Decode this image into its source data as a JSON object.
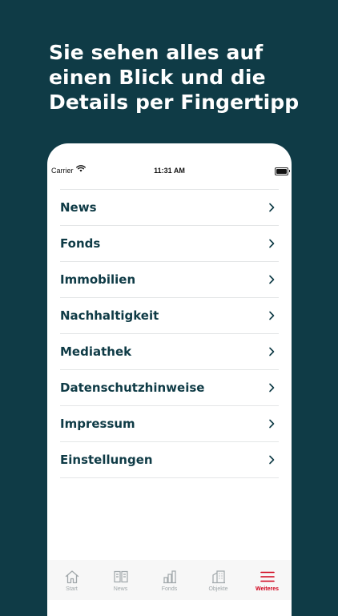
{
  "headline": "Sie sehen alles auf einen Blick und die Details per Fingertipp",
  "status_bar": {
    "carrier": "Carrier",
    "time": "11:31 AM"
  },
  "menu": {
    "items": [
      {
        "label": "News"
      },
      {
        "label": "Fonds"
      },
      {
        "label": "Immobilien"
      },
      {
        "label": "Nachhaltigkeit"
      },
      {
        "label": "Mediathek"
      },
      {
        "label": "Datenschutzhinweise"
      },
      {
        "label": "Impressum"
      },
      {
        "label": "Einstellungen"
      }
    ]
  },
  "tabbar": {
    "tabs": [
      {
        "label": "Start",
        "icon": "home-icon"
      },
      {
        "label": "News",
        "icon": "book-icon"
      },
      {
        "label": "Fonds",
        "icon": "bar-chart-icon"
      },
      {
        "label": "Objekte",
        "icon": "building-icon"
      },
      {
        "label": "Weiteres",
        "icon": "menu-icon",
        "active": true
      }
    ]
  },
  "colors": {
    "background": "#0f3b46",
    "text": "#0f3b46",
    "active_tab": "#d0021b",
    "inactive_tab": "#a0a7aa"
  }
}
